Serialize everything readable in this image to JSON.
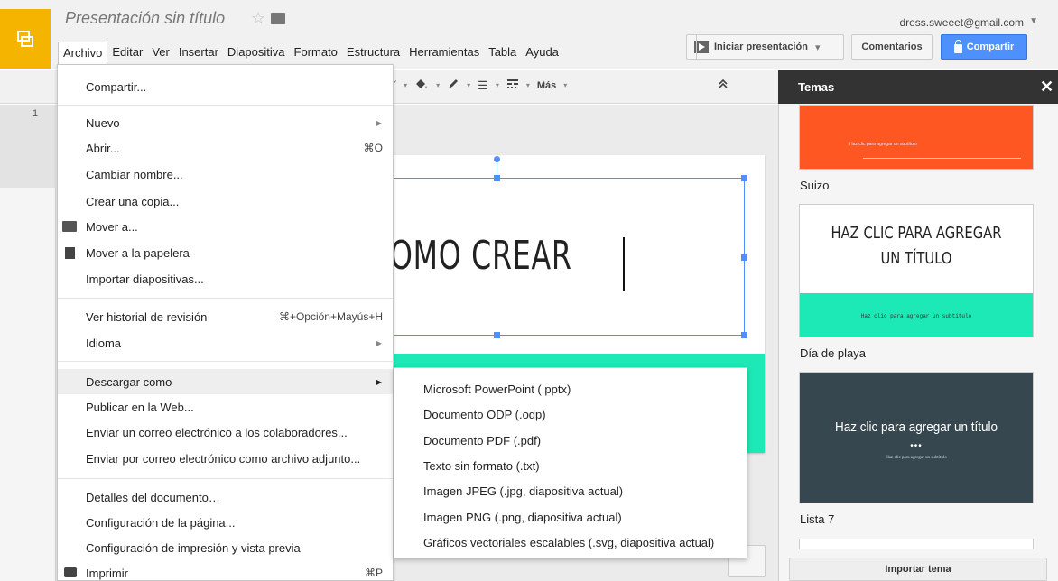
{
  "header": {
    "doc_title": "Presentación sin título",
    "account": "dress.sweeet@gmail.com",
    "present_label": "Iniciar presentación",
    "comments_label": "Comentarios",
    "share_label": "Compartir"
  },
  "menubar": [
    "Archivo",
    "Editar",
    "Ver",
    "Insertar",
    "Diapositiva",
    "Formato",
    "Estructura",
    "Herramientas",
    "Tabla",
    "Ayuda"
  ],
  "toolbar": {
    "more_label": "Más"
  },
  "filmstrip": {
    "slide_number": "1"
  },
  "slide": {
    "title_text": "OMO CREAR ..."
  },
  "archivo_menu": {
    "share": "Compartir...",
    "new": "Nuevo",
    "open": "Abrir...",
    "open_shortcut": "⌘O",
    "rename": "Cambiar nombre...",
    "copy": "Crear una copia...",
    "move": "Mover a...",
    "trash": "Mover a la papelera",
    "import": "Importar diapositivas...",
    "history": "Ver historial de revisión",
    "history_shortcut": "⌘+Opción+Mayús+H",
    "language": "Idioma",
    "download": "Descargar como",
    "publish": "Publicar en la Web...",
    "email_collab": "Enviar un correo electrónico a los colaboradores...",
    "email_attach": "Enviar por correo electrónico como archivo adjunto...",
    "details": "Detalles del documento…",
    "page_setup": "Configuración de la página...",
    "print_setup": "Configuración de impresión y vista previa",
    "print": "Imprimir",
    "print_shortcut": "⌘P"
  },
  "download_submenu": [
    "Microsoft PowerPoint (.pptx)",
    "Documento ODP (.odp)",
    "Documento PDF (.pdf)",
    "Texto sin formato (.txt)",
    "Imagen JPEG (.jpg, diapositiva actual)",
    "Imagen PNG (.png, diapositiva actual)",
    "Gráficos vectoriales escalables (.svg, diapositiva actual)"
  ],
  "themes": {
    "header": "Temas",
    "items": [
      {
        "name": "Suizo",
        "subtitle": "Haz clic para agregar un subtítulo"
      },
      {
        "name": "Día de playa",
        "title": "HAZ CLIC PARA AGREGAR UN TÍTULO",
        "subtitle": "Haz clic para agregar un subtítulo"
      },
      {
        "name": "Lista 7",
        "title": "Haz clic para agregar un título",
        "subtitle": "Haz clic para agregar un subtítulo"
      }
    ],
    "import_label": "Importar tema"
  },
  "colors": {
    "accent": "#4d90fe",
    "logo": "#f4b400",
    "teal": "#1de9b6",
    "orange": "#ff5722"
  }
}
